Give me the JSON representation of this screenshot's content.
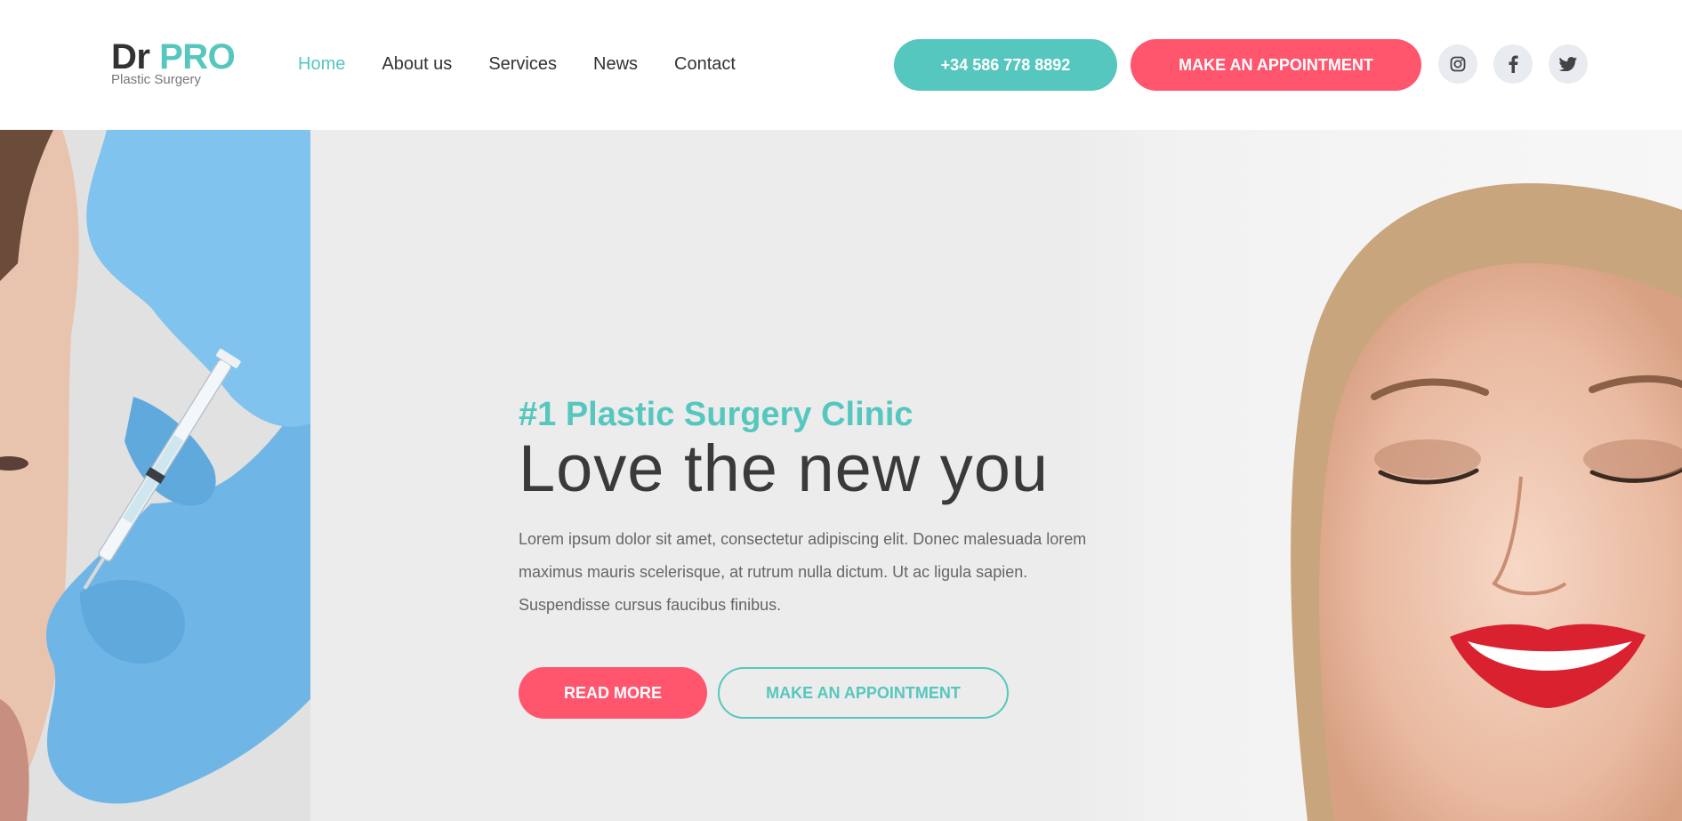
{
  "logo": {
    "primary": "Dr",
    "accent": "PRO",
    "subtitle": "Plastic Surgery"
  },
  "nav": {
    "items": [
      {
        "label": "Home",
        "active": true
      },
      {
        "label": "About us",
        "active": false
      },
      {
        "label": "Services",
        "active": false
      },
      {
        "label": "News",
        "active": false
      },
      {
        "label": "Contact",
        "active": false
      }
    ]
  },
  "header": {
    "phone_label": "+34 586 778 8892",
    "appointment_label": "MAKE AN APPOINTMENT",
    "socials": [
      "instagram-icon",
      "facebook-icon",
      "twitter-icon"
    ]
  },
  "hero": {
    "tagline": "#1 Plastic Surgery Clinic",
    "headline": "Love the new you",
    "description": "Lorem ipsum dolor sit amet, consectetur adipiscing elit. Donec malesuada lorem maximus mauris scelerisque, at rutrum nulla dictum. Ut ac ligula sapien. Suspendisse cursus faucibus finibus.",
    "read_more_label": "READ MORE",
    "appointment_label": "MAKE AN APPOINTMENT",
    "left_image": "injection-procedure-photo",
    "right_image": "smiling-woman-photo"
  },
  "colors": {
    "accent_teal": "#56c7be",
    "accent_pink": "#ff566e",
    "text_dark": "#333333",
    "hero_background": "#ececec"
  }
}
